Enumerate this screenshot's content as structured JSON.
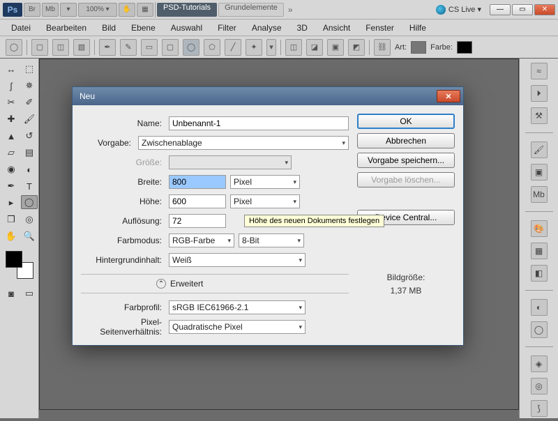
{
  "topbar": {
    "zoom": "100% ▾",
    "tabs": [
      "PSD-Tutorials",
      "Grundelemente"
    ],
    "cslive": "CS Live ▾"
  },
  "menu": [
    "Datei",
    "Bearbeiten",
    "Bild",
    "Ebene",
    "Auswahl",
    "Filter",
    "Analyse",
    "3D",
    "Ansicht",
    "Fenster",
    "Hilfe"
  ],
  "optbar": {
    "art": "Art:",
    "farbe": "Farbe:"
  },
  "dialog": {
    "title": "Neu",
    "labels": {
      "name": "Name:",
      "vorgabe": "Vorgabe:",
      "groesse": "Größe:",
      "breite": "Breite:",
      "hoehe": "Höhe:",
      "aufloesung": "Auflösung:",
      "farbmodus": "Farbmodus:",
      "hintergrund": "Hintergrundinhalt:",
      "erweitert": "Erweitert",
      "farbprofil": "Farbprofil:",
      "pixel_sv": "Pixel-Seitenverhältnis:"
    },
    "values": {
      "name": "Unbenannt-1",
      "vorgabe": "Zwischenablage",
      "groesse": "",
      "breite": "800",
      "breite_unit": "Pixel",
      "hoehe": "600",
      "hoehe_unit": "Pixel",
      "aufloesung": "72",
      "farbmodus": "RGB-Farbe",
      "bit": "8-Bit",
      "hintergrund": "Weiß",
      "farbprofil": "sRGB IEC61966-2.1",
      "pixel_sv": "Quadratische Pixel"
    },
    "buttons": {
      "ok": "OK",
      "abbrechen": "Abbrechen",
      "save": "Vorgabe speichern...",
      "del": "Vorgabe löschen...",
      "device": "Device Central..."
    },
    "info": {
      "label": "Bildgröße:",
      "value": "1,37 MB"
    },
    "tooltip": "Höhe des neuen Dokuments festlegen"
  }
}
